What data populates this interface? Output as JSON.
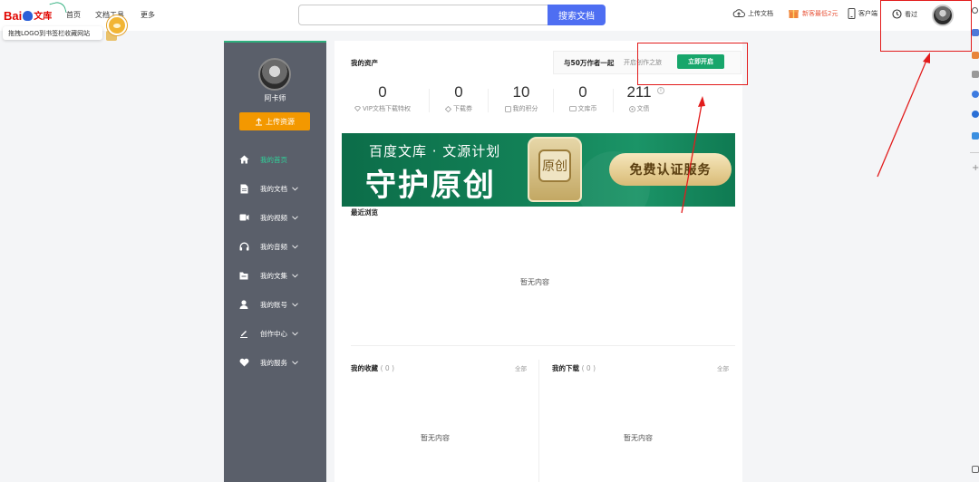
{
  "header": {
    "logo_text": "Bai",
    "logo_wenku": "文库",
    "nav": [
      "首页",
      "文档工具",
      "更多"
    ],
    "search_value": "",
    "search_button": "搜索文档",
    "tools": {
      "upload": "上传文档",
      "newbie": "新客最低2元",
      "client": "客户端",
      "history": "看过"
    }
  },
  "tooltip": {
    "text": "拖拽LOGO到书签栏收藏网站"
  },
  "sidebar": {
    "user_name": "阿卡师",
    "upload_button": "上传资源",
    "menu": [
      {
        "label": "我的首页",
        "icon": "home-icon"
      },
      {
        "label": "我的文档",
        "icon": "document-icon"
      },
      {
        "label": "我的视频",
        "icon": "video-icon"
      },
      {
        "label": "我的音频",
        "icon": "headphones-icon"
      },
      {
        "label": "我的文集",
        "icon": "folder-icon"
      },
      {
        "label": "我的账号",
        "icon": "user-icon"
      },
      {
        "label": "创作中心",
        "icon": "pen-icon"
      },
      {
        "label": "我的服务",
        "icon": "heart-icon"
      }
    ]
  },
  "assets": {
    "title": "我的资产",
    "promo_text": "与50万作者一起",
    "promo_sub": "开启创作之旅",
    "open_button": "立即开启",
    "stats": [
      {
        "value": "0",
        "label": "VIP文档下载特权"
      },
      {
        "value": "0",
        "label": "下载券"
      },
      {
        "value": "10",
        "label": "我的积分"
      },
      {
        "value": "0",
        "label": "文库币"
      },
      {
        "value": "211",
        "label": "文债"
      }
    ]
  },
  "banner": {
    "line1": "百度文库 · 文源计划",
    "line2": "守护原创",
    "badge": "原创",
    "cta": "免费认证服务"
  },
  "recent": {
    "title": "最近浏览",
    "empty": "暂无内容"
  },
  "favorites": {
    "title": "我的收藏",
    "count": "( 0 )",
    "all": "全部",
    "empty": "暂无内容"
  },
  "downloads": {
    "title": "我的下载",
    "count": "( 0 )",
    "all": "全部",
    "empty": "暂无内容"
  },
  "colors": {
    "accent_green": "#17a66b",
    "search_blue": "#4e6ef2",
    "upload_orange": "#f39800",
    "sidebar_bg": "#5a5f6a",
    "annotation_red": "#e21c1c"
  }
}
